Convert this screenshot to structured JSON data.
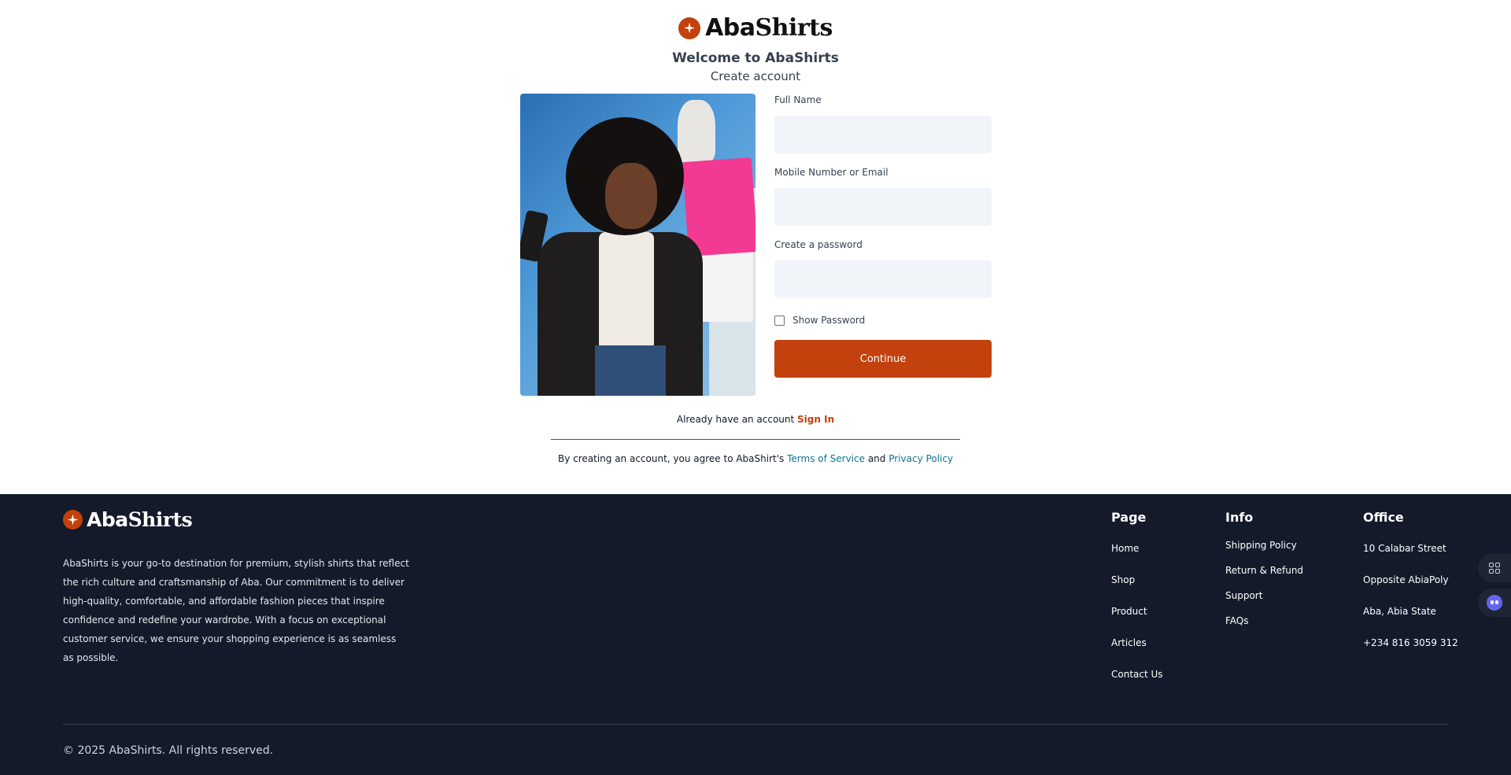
{
  "brand": {
    "part1": "Aba",
    "part2": "Shirts",
    "accent": "#c2410c"
  },
  "header": {
    "welcome": "Welcome to AbaShirts",
    "subtitle": "Create account"
  },
  "form": {
    "full_name_label": "Full Name",
    "full_name_value": "",
    "contact_label": "Mobile Number or Email",
    "contact_value": "",
    "password_label": "Create a password",
    "password_value": "",
    "show_password_label": "Show Password",
    "show_password_checked": false,
    "continue_label": "Continue"
  },
  "signin": {
    "prompt": "Already have an account",
    "link": "Sign In"
  },
  "terms": {
    "prefix": "By creating an account, you agree to AbaShirt's",
    "tos": "Terms of Service",
    "and": "and",
    "privacy": "Privacy Policy"
  },
  "footer": {
    "about": "AbaShirts is your go-to destination for premium, stylish shirts that reflect the rich culture and craftsmanship of Aba. Our commitment is to deliver high-quality, comfortable, and affordable fashion pieces that inspire confidence and redefine your wardrobe. With a focus on exceptional customer service, we ensure your shopping experience is as seamless as possible.",
    "page": {
      "title": "Page",
      "items": [
        "Home",
        "Shop",
        "Product",
        "Articles",
        "Contact Us"
      ]
    },
    "info": {
      "title": "Info",
      "items": [
        "Shipping Policy",
        "Return & Refund",
        "Support",
        "FAQs"
      ]
    },
    "office": {
      "title": "Office",
      "items": [
        "10 Calabar Street",
        "Opposite AbiaPoly",
        "Aba, Abia State",
        "+234 816 3059 312"
      ]
    },
    "copyright": "© 2025 AbaShirts. All rights reserved."
  }
}
